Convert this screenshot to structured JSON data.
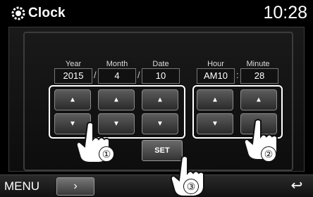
{
  "header": {
    "title": "Clock",
    "time": "10:28",
    "app_icon": "gear-clock-icon"
  },
  "columns": [
    {
      "label": "Year",
      "value": "2015"
    },
    {
      "label": "Month",
      "value": "4"
    },
    {
      "label": "Date",
      "value": "10"
    },
    {
      "label": "Hour",
      "value": "AM10"
    },
    {
      "label": "Minute",
      "value": "28"
    }
  ],
  "separators": {
    "date_sep": "/",
    "time_sep": ":"
  },
  "buttons": {
    "up_glyph": "▲",
    "down_glyph": "▼",
    "set_label": "SET"
  },
  "bottom": {
    "menu_label": "MENU",
    "next_glyph": "›",
    "back_glyph": "↩"
  },
  "callouts": [
    "①",
    "②",
    "③"
  ]
}
